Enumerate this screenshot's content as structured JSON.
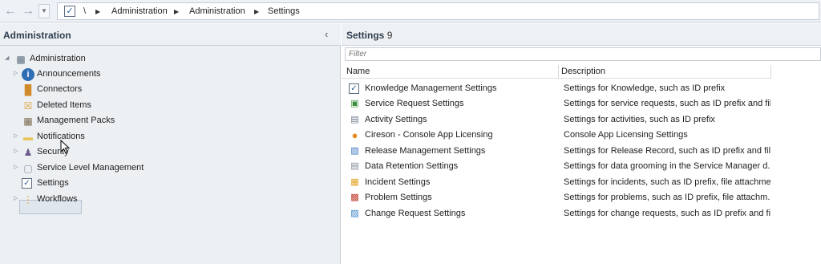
{
  "nav": {
    "back_icon": "back-arrow-icon",
    "forward_icon": "forward-arrow-icon",
    "dropdown_icon": "chevron-down-icon",
    "crumb_root": "\\",
    "breadcrumb": [
      "Administration",
      "Administration",
      "Settings"
    ]
  },
  "left": {
    "title": "Administration",
    "root": "Administration",
    "items": [
      {
        "label": "Announcements",
        "icon": "info-icon",
        "expandable": true
      },
      {
        "label": "Connectors",
        "icon": "connector-icon",
        "expandable": false
      },
      {
        "label": "Deleted Items",
        "icon": "deleted-items-icon",
        "expandable": false
      },
      {
        "label": "Management Packs",
        "icon": "management-pack-icon",
        "expandable": false
      },
      {
        "label": "Notifications",
        "icon": "folder-icon",
        "expandable": true
      },
      {
        "label": "Security",
        "icon": "security-icon",
        "expandable": true
      },
      {
        "label": "Service Level Management",
        "icon": "document-icon",
        "expandable": true
      },
      {
        "label": "Settings",
        "icon": "checkbox-icon",
        "expandable": false,
        "selected": true
      },
      {
        "label": "Workflows",
        "icon": "workflow-icon",
        "expandable": true
      }
    ]
  },
  "right": {
    "title": "Settings",
    "count": "9",
    "filter_placeholder": "Filter",
    "columns": {
      "name": "Name",
      "description": "Description"
    },
    "rows": [
      {
        "name": "Knowledge Management Settings",
        "description": "Settings for Knowledge, such as ID prefix",
        "icon": "checkbox-icon"
      },
      {
        "name": "Service Request Settings",
        "description": "Settings for service requests, such as ID prefix and fil...",
        "icon": "service-request-icon"
      },
      {
        "name": "Activity Settings",
        "description": "Settings for activities, such as ID prefix",
        "icon": "activity-icon"
      },
      {
        "name": "Cireson - Console App Licensing",
        "description": "Console App Licensing Settings",
        "icon": "cireson-icon"
      },
      {
        "name": "Release Management Settings",
        "description": "Settings for Release Record, such as ID prefix and file...",
        "icon": "release-icon"
      },
      {
        "name": "Data Retention Settings",
        "description": "Settings for data grooming in the Service Manager d...",
        "icon": "data-retention-icon"
      },
      {
        "name": "Incident Settings",
        "description": "Settings for incidents, such as ID prefix, file attachme...",
        "icon": "incident-icon"
      },
      {
        "name": "Problem Settings",
        "description": "Settings for problems, such as ID prefix, file attachm...",
        "icon": "problem-icon"
      },
      {
        "name": "Change Request Settings",
        "description": "Settings for change requests, such as ID prefix and fi...",
        "icon": "change-request-icon"
      }
    ]
  },
  "colors": {
    "pane_bg": "#edf0f3",
    "header_bg": "#eef1f4",
    "selected_bg": "#dfe6ee",
    "border": "#c9d0d8"
  }
}
